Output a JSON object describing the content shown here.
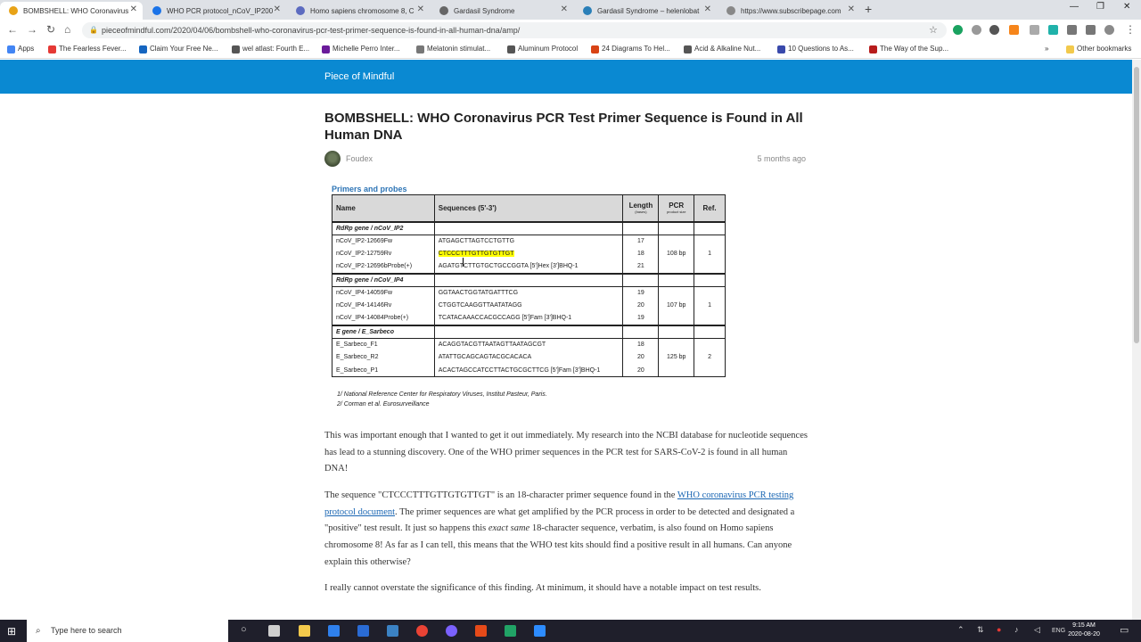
{
  "browser": {
    "tabs": [
      {
        "title": "BOMBSHELL: WHO Coronavirus",
        "active": true,
        "color": "#e8a317"
      },
      {
        "title": "WHO PCR protocol_nCoV_IP200",
        "active": false,
        "color": "#1a73e8"
      },
      {
        "title": "Homo sapiens chromosome 8, C",
        "active": false,
        "color": "#5c6bc0"
      },
      {
        "title": "Gardasil Syndrome",
        "active": false,
        "color": "#666666"
      },
      {
        "title": "Gardasil Syndrome – helenlobat",
        "active": false,
        "color": "#2a7fb8"
      },
      {
        "title": "https://www.subscribepage.com",
        "active": false,
        "color": "#888888"
      }
    ],
    "new_tab": "+",
    "window_controls": {
      "minimize": "—",
      "maximize": "❐",
      "close": "✕"
    },
    "url": "pieceofmindful.com/2020/04/06/bombshell-who-coronavirus-pcr-test-primer-sequence-is-found-in-all-human-dna/amp/",
    "bookmarks": [
      {
        "label": "Apps",
        "color": "#4285f4"
      },
      {
        "label": "The Fearless Fever...",
        "color": "#e53935"
      },
      {
        "label": "Claim Your Free Ne...",
        "color": "#1565c0"
      },
      {
        "label": "wel atlast: Fourth E...",
        "color": "#555555"
      },
      {
        "label": "Michelle Perro Inter...",
        "color": "#6a1b9a"
      },
      {
        "label": "Melatonin stimulat...",
        "color": "#777777"
      },
      {
        "label": "Aluminum Protocol",
        "color": "#555555"
      },
      {
        "label": "24 Diagrams To Hel...",
        "color": "#d84315"
      },
      {
        "label": "Acid & Alkaline Nut...",
        "color": "#555555"
      },
      {
        "label": "10 Questions to As...",
        "color": "#3949ab"
      },
      {
        "label": "The Way of the Sup...",
        "color": "#b71c1c"
      }
    ],
    "other_bookmarks": "Other bookmarks"
  },
  "site": {
    "name": "Piece of Mindful",
    "brand_color": "#0a89d2"
  },
  "article": {
    "title": "BOMBSHELL: WHO Coronavirus PCR Test Primer Sequence is Found in All Human DNA",
    "author": "Foudex",
    "date": "5 months ago",
    "figure": {
      "caption": "Primers and probes",
      "headers": {
        "name": "Name",
        "sequence": "Sequences (5'-3')",
        "length": "Length",
        "length_sub": "(bases)",
        "pcr": "PCR",
        "pcr_sub": "product size",
        "ref": "Ref."
      },
      "groups": [
        {
          "label": "RdRp gene / nCoV_IP2",
          "pcr": "108 bp",
          "ref": "1",
          "rows": [
            {
              "name": "nCoV_IP2-12669Fw",
              "seq": "ATGAGCTTAGTCCTGTTG",
              "len": "17"
            },
            {
              "name": "nCoV_IP2-12759Rv",
              "seq": "CTCCCTTTGTTGTGTTGT",
              "len": "18"
            },
            {
              "name": "nCoV_IP2-12696bProbe(+)",
              "seq": "AGATGTCTTGTGCTGCCGGTA [5']Hex [3']BHQ-1",
              "len": "21"
            }
          ]
        },
        {
          "label": "RdRp gene / nCoV_IP4",
          "pcr": "107 bp",
          "ref": "1",
          "rows": [
            {
              "name": "nCoV_IP4-14059Fw",
              "seq": "GGTAACTGGTATGATTTCG",
              "len": "19"
            },
            {
              "name": "nCoV_IP4-14146Rv",
              "seq": "CTGGTCAAGGTTAATATAGG",
              "len": "20"
            },
            {
              "name": "nCoV_IP4-14084Probe(+)",
              "seq": "TCATACAAACCACGCCAGG [5']Fam [3']BHQ-1",
              "len": "19"
            }
          ]
        },
        {
          "label": "E gene / E_Sarbeco",
          "pcr": "125 bp",
          "ref": "2",
          "rows": [
            {
              "name": "E_Sarbeco_F1",
              "seq": "ACAGGTACGTTAATAGTTAATAGCGT",
              "len": "18"
            },
            {
              "name": "E_Sarbeco_R2",
              "seq": "ATATTGCAGCAGTACGCACACA",
              "len": "20"
            },
            {
              "name": "E_Sarbeco_P1",
              "seq": "ACACTAGCCATCCTTACTGCGCTTCG [5']Fam [3']BHQ-1",
              "len": "20"
            }
          ]
        }
      ],
      "footnotes": [
        "1/ National Reference Center for Respiratory Viruses, Institut Pasteur, Paris.",
        "2/ Corman et al. Eurosurveillance"
      ]
    },
    "p1": "This was important enough that I wanted to get it out immediately. My research into the NCBI database for nucleotide sequences has lead to a stunning discovery. One of the WHO primer sequences in the PCR test for SARS-CoV-2 is found in all human DNA!",
    "p2_a": "The sequence \"CTCCCTTTGTTGTGTTGT\" is an 18-character primer sequence found in the ",
    "p2_link": "WHO coronavirus PCR testing protocol document",
    "p2_b": ". The primer sequences are what get amplified by the PCR process in order to be detected and designated a \"positive\" test result. It just so happens this ",
    "p2_em": "exact same",
    "p2_c": " 18-character sequence, verbatim, is also found on Homo sapiens chromosome 8! As far as I can tell, this means that the WHO test kits should find a positive result in all humans. Can anyone explain this otherwise?",
    "p3": "I really cannot overstate the significance of this finding. At minimum, it should have a notable impact on test results."
  },
  "taskbar": {
    "search_placeholder": "Type here to search",
    "lang": "ENG",
    "time": "9:15 AM",
    "date": "2020-08-20"
  }
}
